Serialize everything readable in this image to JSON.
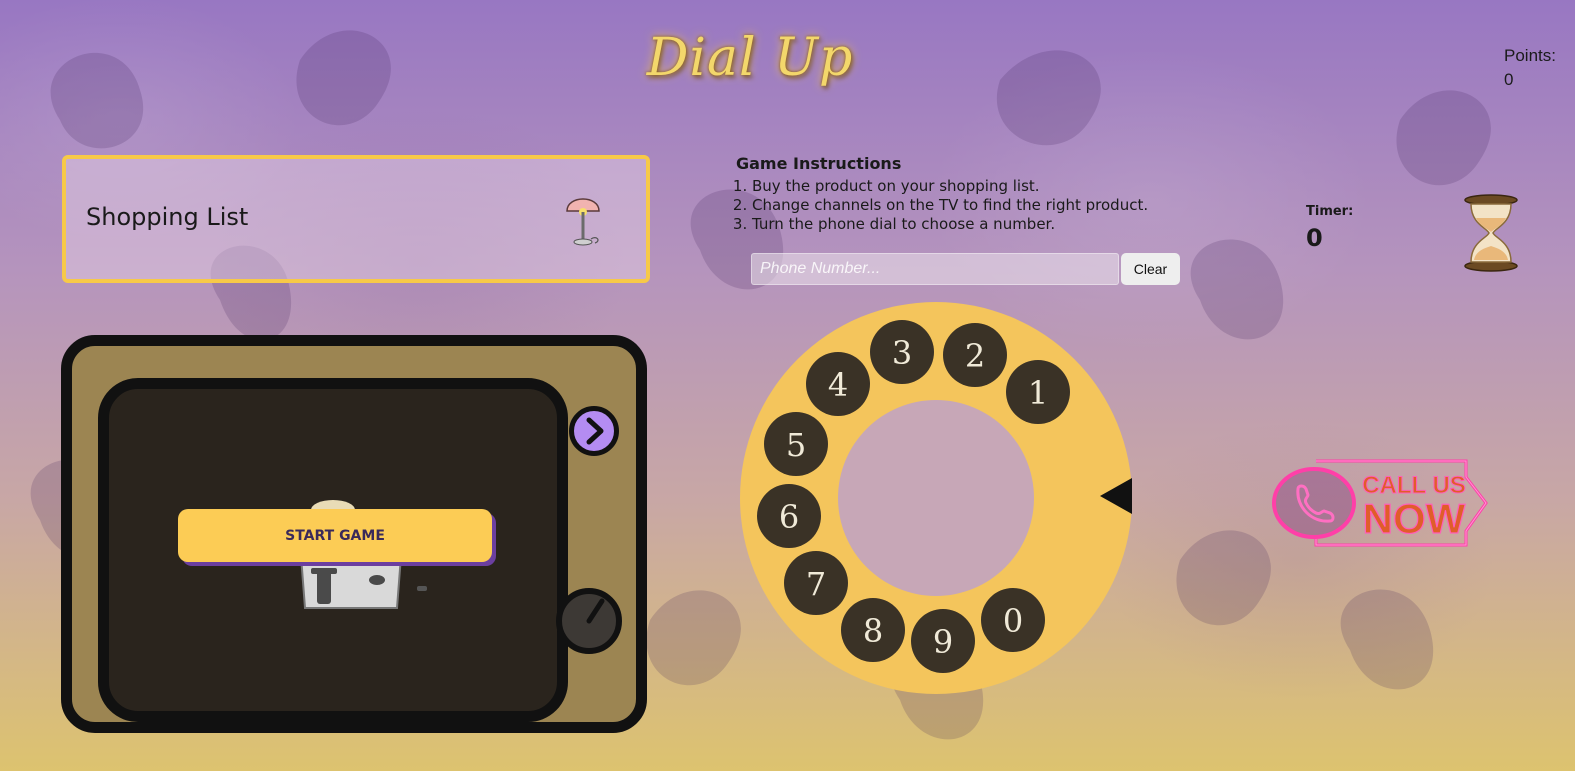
{
  "title": "Dial Up",
  "points": {
    "label": "Points:",
    "value": "0"
  },
  "shopping_list": {
    "label": "Shopping List",
    "item_icon": "lamp-icon"
  },
  "instructions": {
    "heading": "Game Instructions",
    "steps": [
      "Buy the product on your shopping list.",
      "Change channels on the TV to find the right product.",
      "Turn the phone dial to choose a number."
    ]
  },
  "phone": {
    "placeholder": "Phone Number...",
    "value": "",
    "clear_label": "Clear"
  },
  "timer": {
    "label": "Timer:",
    "value": "0"
  },
  "tv": {
    "start_label": "START GAME",
    "product_icon": "toaster-icon"
  },
  "dial": {
    "digits": [
      "1",
      "2",
      "3",
      "4",
      "5",
      "6",
      "7",
      "8",
      "9",
      "0"
    ]
  },
  "callout": {
    "line1": "CALL US",
    "line2": "NOW"
  },
  "colors": {
    "accent": "#fccc55",
    "button_shadow": "#6b3fa0",
    "channel_button": "#b48cf2",
    "neon": "#ff4fb0",
    "dial_ring": "#f4c55c"
  }
}
